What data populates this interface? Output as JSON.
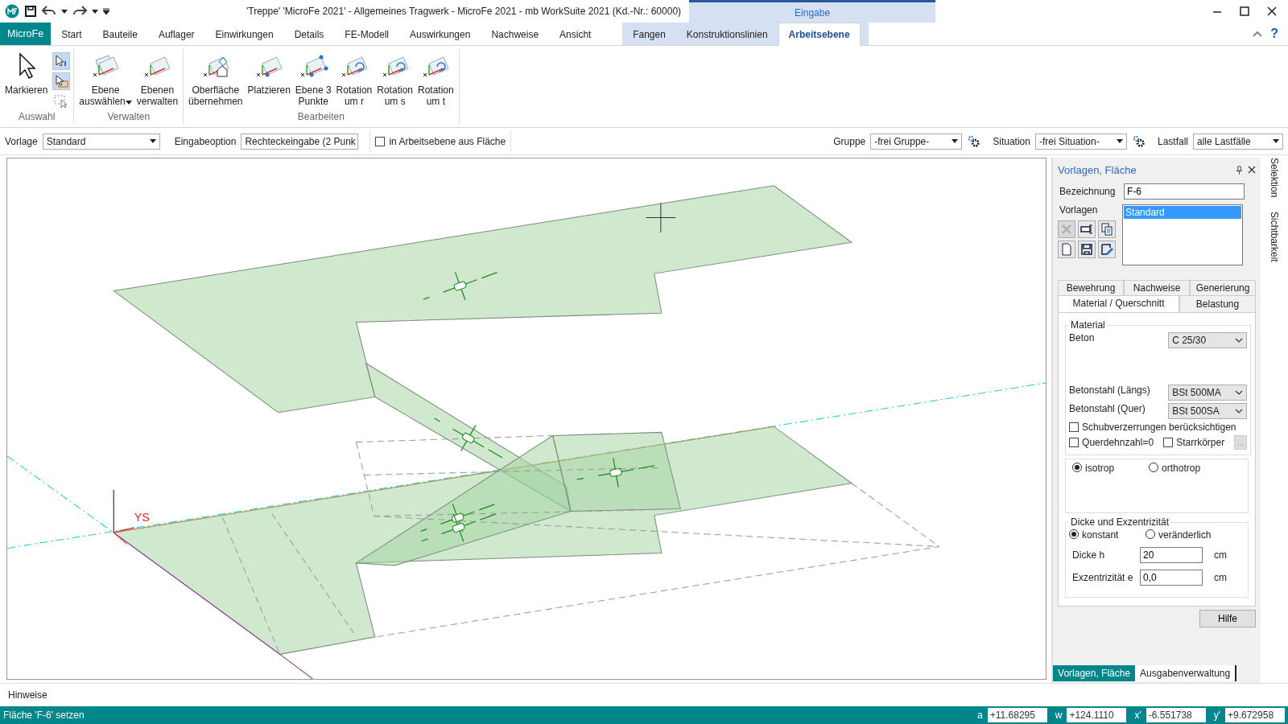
{
  "window": {
    "title": "'Treppe' 'MicroFe 2021' -  Allgemeines Tragwerk - MicroFe 2021 -  mb WorkSuite 2021 (Kd.-Nr.: 60000)",
    "help": "?"
  },
  "app_button": "MicroFe",
  "tabs": [
    {
      "label": "Start",
      "selected": false
    },
    {
      "label": "Bauteile",
      "selected": false
    },
    {
      "label": "Auflager",
      "selected": false
    },
    {
      "label": "Einwirkungen",
      "selected": false
    },
    {
      "label": "Details",
      "selected": false
    },
    {
      "label": "FE-Modell",
      "selected": false
    },
    {
      "label": "Auswirkungen",
      "selected": false
    },
    {
      "label": "Nachweise",
      "selected": false
    },
    {
      "label": "Ansicht",
      "selected": false
    }
  ],
  "context_group": {
    "label": "Eingabe",
    "tabs": [
      {
        "label": "Fangen",
        "selected": false
      },
      {
        "label": "Konstruktionslinien",
        "selected": false
      },
      {
        "label": "Arbeitsebene",
        "selected": true
      }
    ]
  },
  "ribbon": {
    "groups": [
      {
        "label": "Auswahl",
        "buttons": [
          {
            "kind": "pointer",
            "lines": [
              "Markieren"
            ],
            "dropdown": false
          }
        ],
        "small_tools": [
          {
            "kind": "pointer-info",
            "selected": true
          },
          {
            "kind": "pointer-rect",
            "selected": true
          },
          {
            "kind": "pointer-dashed",
            "selected": false
          }
        ]
      },
      {
        "label": "Verwalten",
        "buttons": [
          {
            "kind": "planes",
            "lines": [
              "Ebene",
              "auswählen"
            ],
            "dropdown": true
          },
          {
            "kind": "plane",
            "lines": [
              "Ebenen",
              "verwalten"
            ],
            "dropdown": false
          }
        ]
      },
      {
        "label": "Bearbeiten",
        "buttons": [
          {
            "kind": "house",
            "lines": [
              "Oberfläche",
              "übernehmen"
            ],
            "dropdown": false
          },
          {
            "kind": "dot",
            "lines": [
              "Platzieren"
            ],
            "dropdown": false
          },
          {
            "kind": "points",
            "lines": [
              "Ebene 3",
              "Punkte"
            ],
            "dropdown": false
          },
          {
            "kind": "rotate",
            "lines": [
              "Rotation",
              "um r"
            ],
            "dropdown": false
          },
          {
            "kind": "rotate",
            "lines": [
              "Rotation",
              "um s"
            ],
            "dropdown": false
          },
          {
            "kind": "rotate",
            "lines": [
              "Rotation",
              "um t"
            ],
            "dropdown": false
          }
        ]
      }
    ]
  },
  "toolbar": {
    "vorlage": {
      "label": "Vorlage",
      "value": "Standard"
    },
    "eingabeoption": {
      "label": "Eingabeoption",
      "value": "Rechteckeingabe (2 Punk"
    },
    "checkbox": {
      "label": "in Arbeitsebene aus Fläche",
      "checked": false
    },
    "right": [
      {
        "label": "Gruppe",
        "value": "-frei Gruppe-",
        "gear": true
      },
      {
        "label": "Situation",
        "value": "-frei Situation-",
        "gear": true
      },
      {
        "label": "Lastfall",
        "value": "alle Lastfälle",
        "gear": false
      }
    ]
  },
  "canvas": {
    "axis_label": "YS"
  },
  "panel": {
    "title": "Vorlagen, Fläche",
    "bezeichnung": {
      "label": "Bezeichnung",
      "value": "F-6"
    },
    "vorlagen": {
      "label": "Vorlagen",
      "items": [
        {
          "label": "Standard",
          "selected": true
        }
      ],
      "tools": [
        {
          "kind": "delete",
          "disabled": true
        },
        {
          "kind": "rename",
          "disabled": false
        },
        {
          "kind": "copy",
          "disabled": false
        },
        {
          "kind": "new",
          "disabled": false
        },
        {
          "kind": "save",
          "disabled": false
        },
        {
          "kind": "edit",
          "disabled": false
        }
      ]
    },
    "tab_rows": [
      [
        {
          "label": "Bewehrung",
          "selected": false
        },
        {
          "label": "Nachweise",
          "selected": false
        },
        {
          "label": "Generierung",
          "selected": false
        }
      ],
      [
        {
          "label": "Material / Querschnitt",
          "selected": true
        },
        {
          "label": "Belastung",
          "selected": false
        }
      ]
    ],
    "material": {
      "legend": "Material",
      "fields": [
        {
          "label": "Beton",
          "value": "C 25/30"
        },
        {
          "label": "Betonstahl (Längs)",
          "value": "BSt 500MA"
        },
        {
          "label": "Betonstahl (Quer)",
          "value": "BSt 500SA"
        }
      ],
      "checkboxes": [
        {
          "label": "Schubverzerrungen berücksichtigen",
          "checked": false
        },
        {
          "label": "Querdehnzahl=0",
          "checked": false
        },
        {
          "label": "Starrkörper",
          "checked": false
        }
      ],
      "more_button": {
        "label": "...",
        "disabled": true
      }
    },
    "isotropy": [
      {
        "label": "isotrop",
        "selected": true
      },
      {
        "label": "orthotrop",
        "selected": false
      }
    ],
    "thickness": {
      "legend": "Dicke und Exzentrizität",
      "modes": [
        {
          "label": "konstant",
          "selected": true
        },
        {
          "label": "veränderlich",
          "selected": false
        }
      ],
      "fields": [
        {
          "label": "Dicke h",
          "value": "20",
          "unit": "cm"
        },
        {
          "label": "Exzentrizität e",
          "value": "0,0",
          "unit": "cm"
        }
      ]
    },
    "help_button": "Hilfe",
    "bottom_tabs": [
      {
        "label": "Vorlagen, Fläche",
        "selected": true
      },
      {
        "label": "Ausgabenverwaltung",
        "selected": false
      }
    ]
  },
  "side_tabs": [
    "Selektion",
    "Sichtbarkeit"
  ],
  "hints": {
    "label": "Hinweise"
  },
  "status_bar": {
    "message": "Fläche 'F-6' setzen",
    "coords": [
      {
        "label": "a",
        "value": "+11.68295"
      },
      {
        "label": "w",
        "value": "+124.1110"
      },
      {
        "label": "x'",
        "value": "-6.551738"
      },
      {
        "label": "y'",
        "value": "+9.672958"
      }
    ]
  }
}
